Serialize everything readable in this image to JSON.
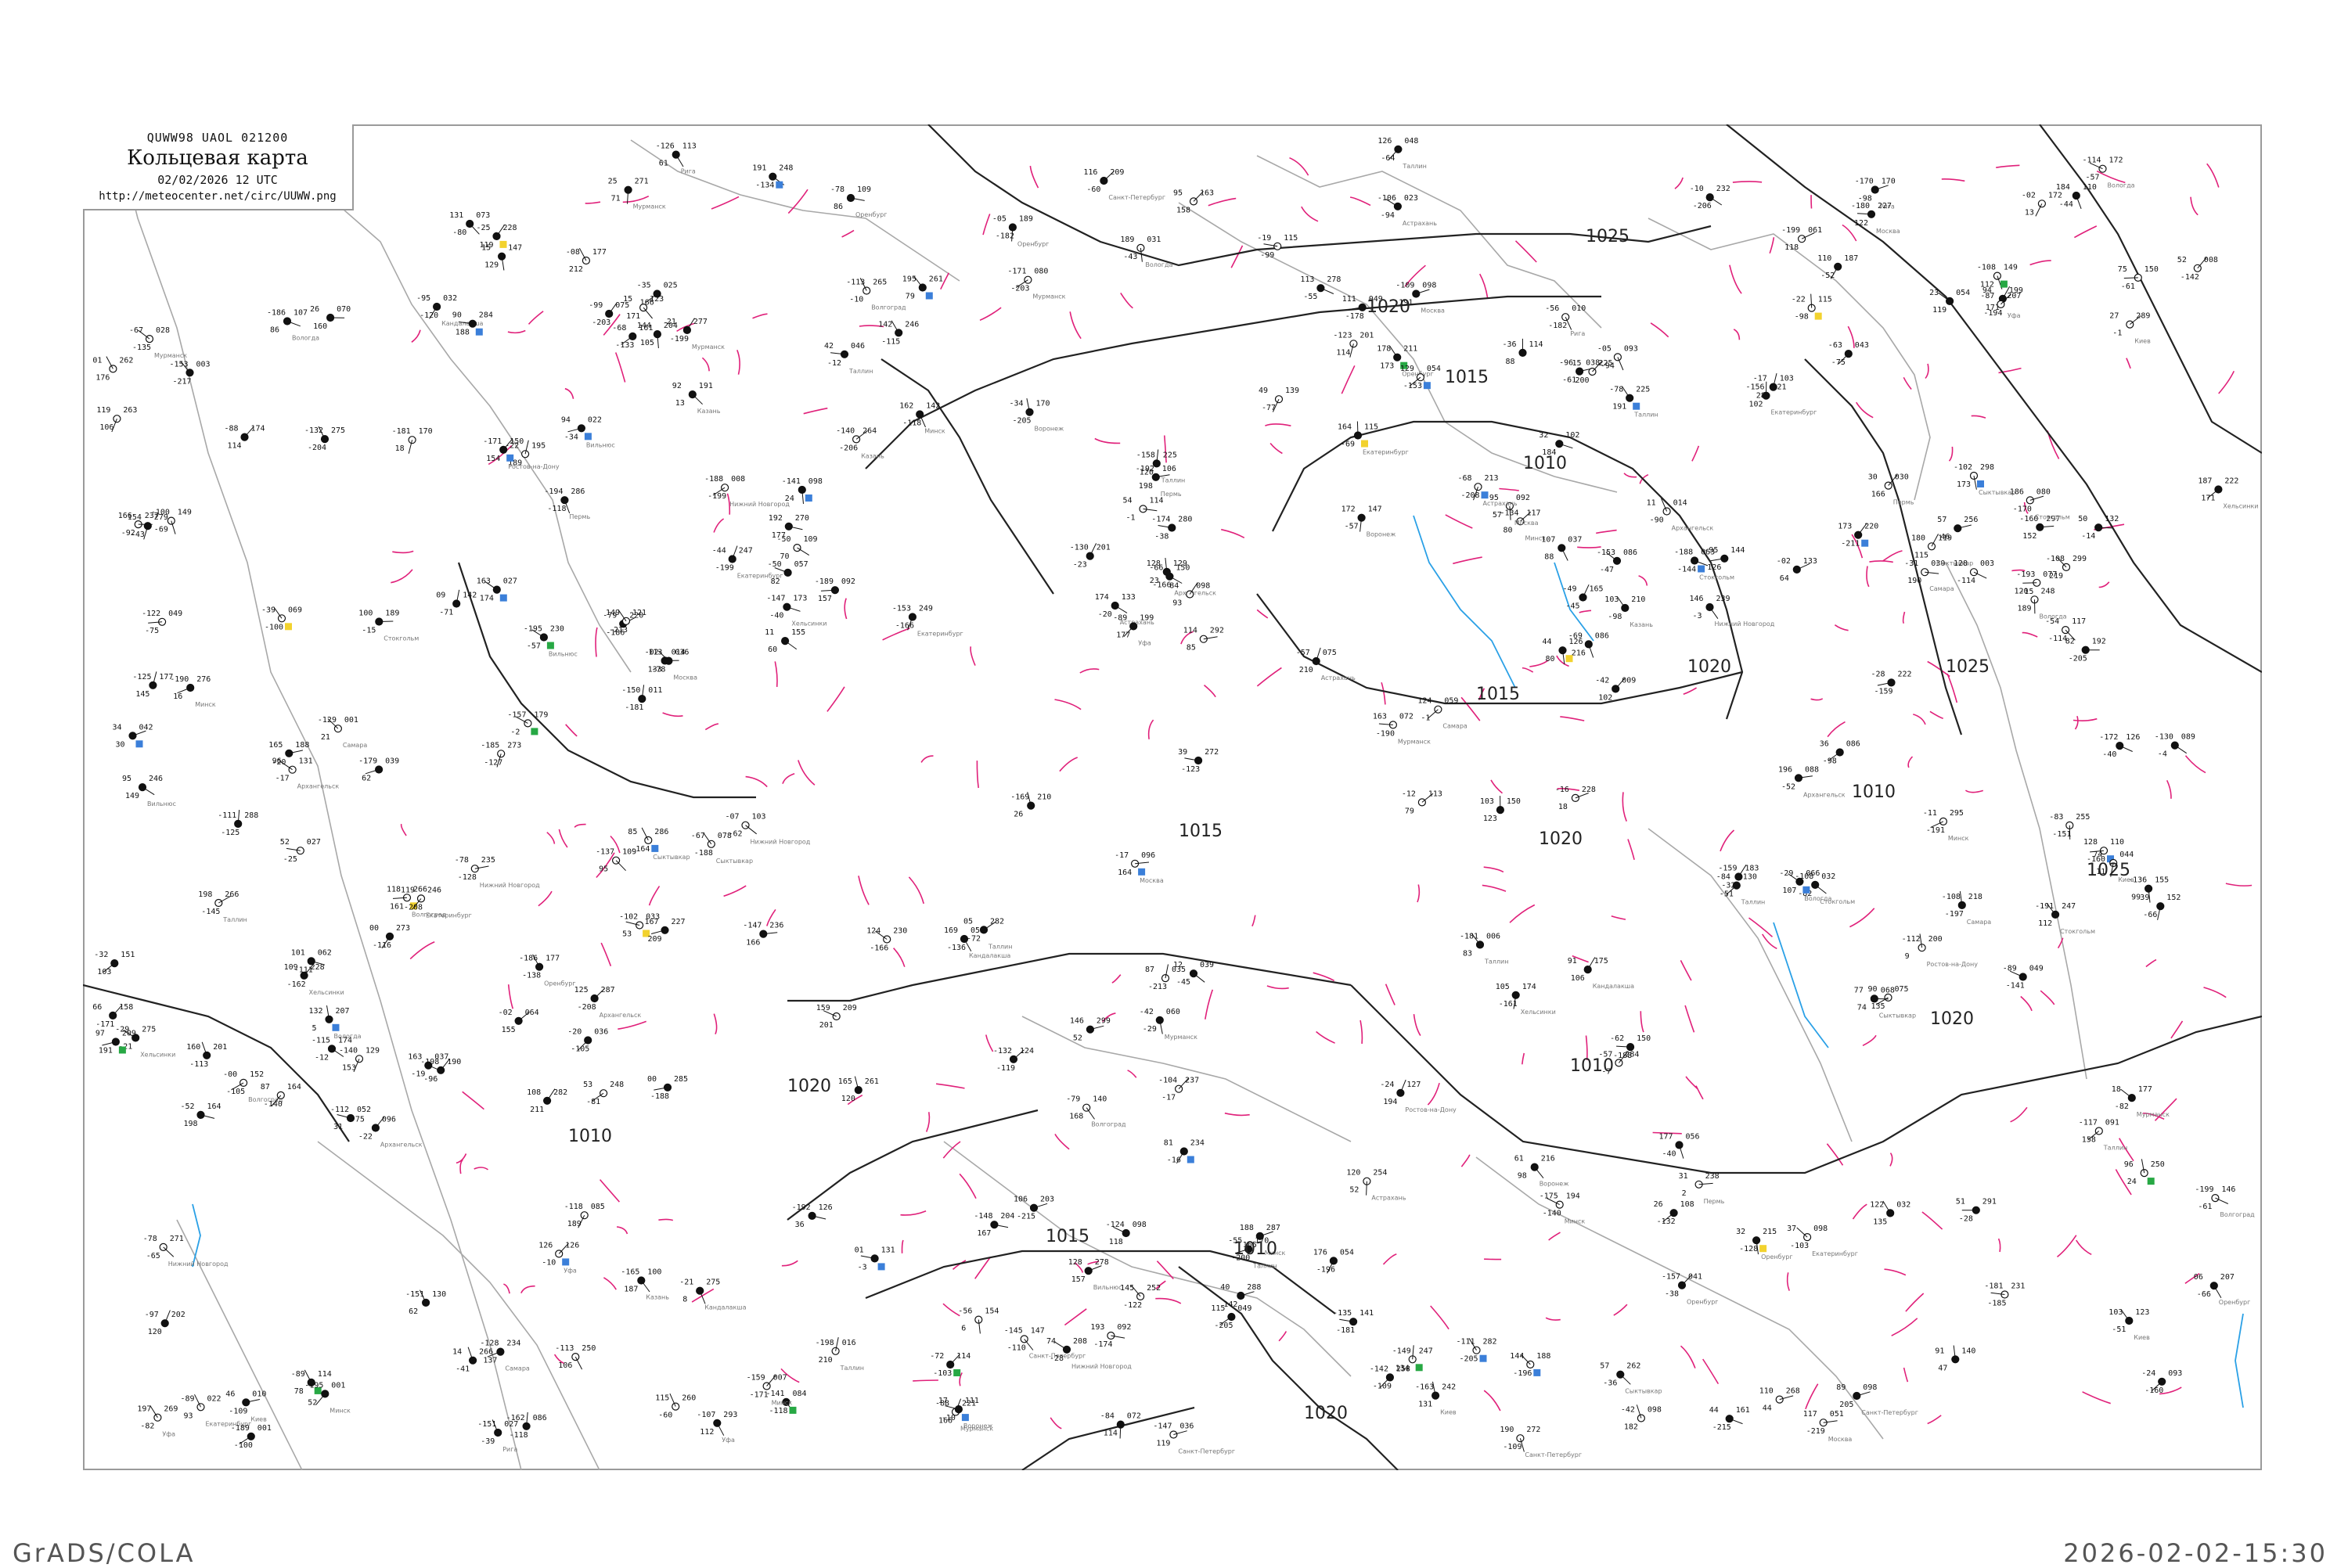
{
  "header": {
    "code": "QUWW98  UAOL  021200",
    "title": "Кольцевая карта",
    "datetime": "02/02/2026 12 UTC",
    "url": "http://meteocenter.net/circ/UUWW.png"
  },
  "footer": {
    "software": "GrADS/COLA",
    "timestamp": "2026-02-02-15:30"
  },
  "isobars": [
    {
      "value": "1025",
      "count": 3
    },
    {
      "value": "1020",
      "count": 6
    },
    {
      "value": "1015",
      "count": 4
    },
    {
      "value": "1010",
      "count": 5
    }
  ],
  "isobar_labels": [
    "1025",
    "1020",
    "1015",
    "1010",
    "1025",
    "1020",
    "1015",
    "1020",
    "1020",
    "1015",
    "1010",
    "1010",
    "1010",
    "1020",
    "1025",
    "1015",
    "1010",
    "1020"
  ],
  "station_names": [
    "Кандалакша",
    "Мурманск",
    "Архангельск",
    "Сыктывкар",
    "Вологда",
    "Санкт-Петербург",
    "Москва",
    "Нижний Новгород",
    "Казань",
    "Самара",
    "Оренбург",
    "Уфа",
    "Пермь",
    "Екатеринбург",
    "Воронеж",
    "Ростов-на-Дону",
    "Волгоград",
    "Астрахань",
    "Минск",
    "Киев",
    "Рига",
    "Вильнюс",
    "Таллин",
    "Хельсинки",
    "Стокгольм"
  ],
  "colors": {
    "isobar": "#222222",
    "coast": "#a8a8a8",
    "isallobar_rise": "#e0207a",
    "isallobar_fall": "#2aa0e6",
    "frame": "#9a9a9a",
    "footer_text": "#555555"
  }
}
